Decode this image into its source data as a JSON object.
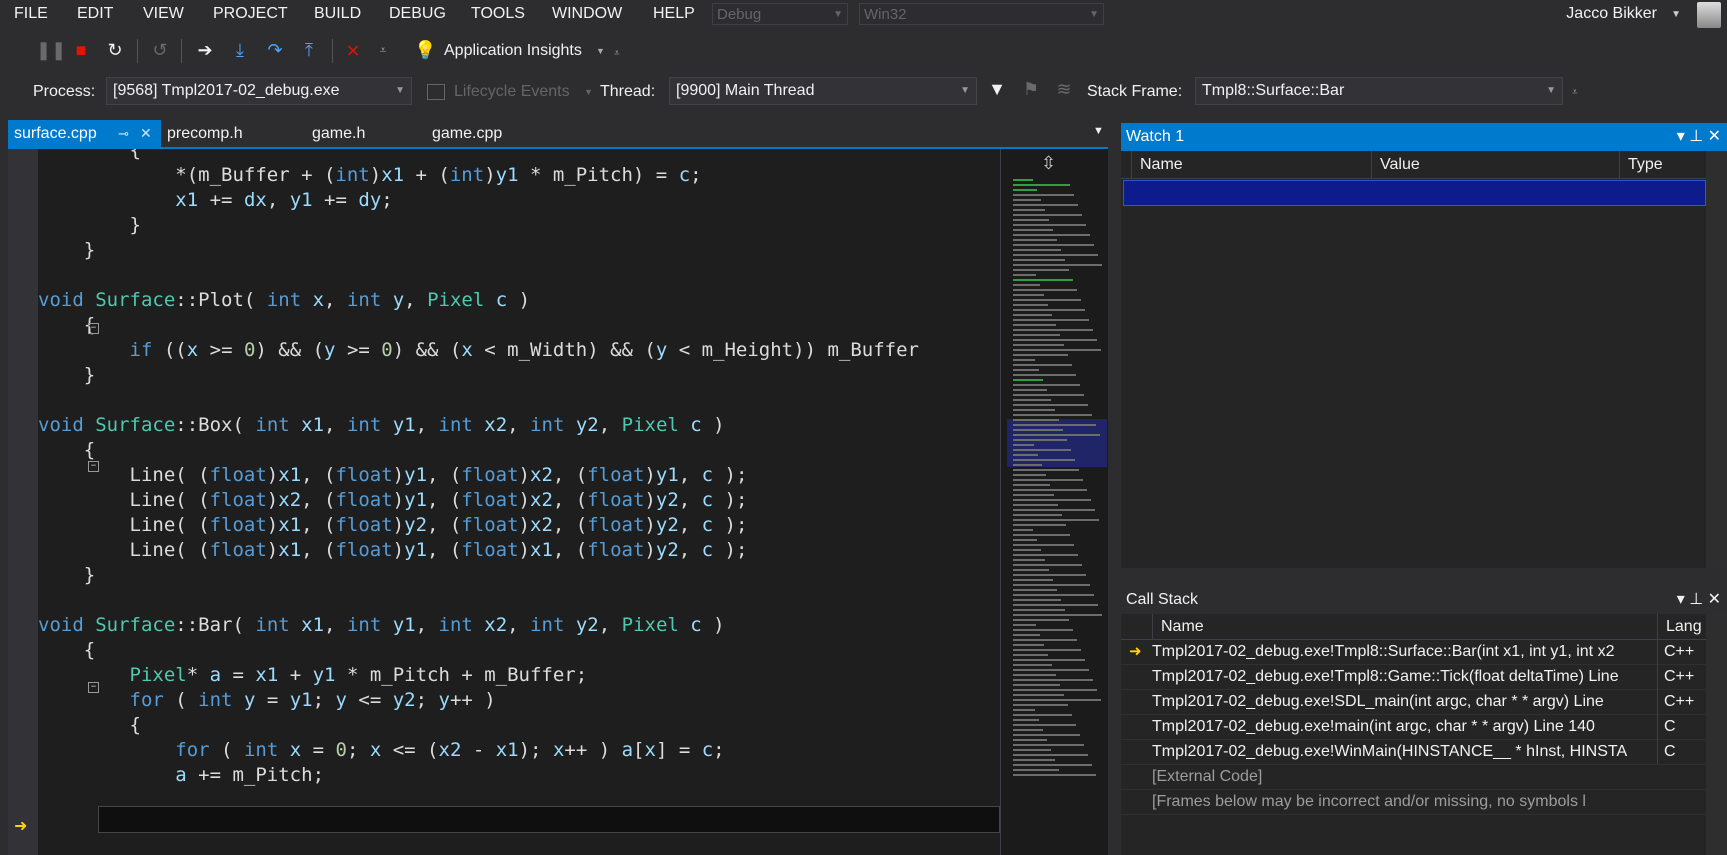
{
  "menu": [
    "FILE",
    "EDIT",
    "VIEW",
    "PROJECT",
    "BUILD",
    "DEBUG",
    "TOOLS",
    "WINDOW",
    "HELP"
  ],
  "config_combo": "Debug",
  "platform_combo": "Win32",
  "user": "Jacco Bikker",
  "toolbar": {
    "insights": "Application Insights"
  },
  "debug_location": {
    "process_label": "Process:",
    "process_value": "[9568] Tmpl2017-02_debug.exe",
    "lifecycle": "Lifecycle Events",
    "thread_label": "Thread:",
    "thread_value": "[9900] Main Thread",
    "stackframe_label": "Stack Frame:",
    "stackframe_value": "Tmpl8::Surface::Bar"
  },
  "tabs": [
    "surface.cpp",
    "precomp.h",
    "game.h",
    "game.cpp"
  ],
  "watch": {
    "title": "Watch 1",
    "columns": [
      "Name",
      "Value",
      "Type"
    ]
  },
  "callstack": {
    "title": "Call Stack",
    "columns": [
      "Name",
      "Lang"
    ],
    "rows": [
      {
        "name": "Tmpl2017-02_debug.exe!Tmpl8::Surface::Bar(int x1, int y1, int x2",
        "lang": "C++"
      },
      {
        "name": "Tmpl2017-02_debug.exe!Tmpl8::Game::Tick(float deltaTime) Line",
        "lang": "C++"
      },
      {
        "name": "Tmpl2017-02_debug.exe!SDL_main(int argc, char * * argv) Line",
        "lang": "C++"
      },
      {
        "name": "Tmpl2017-02_debug.exe!main(int argc, char * * argv) Line 140",
        "lang": "C"
      },
      {
        "name": "Tmpl2017-02_debug.exe!WinMain(HINSTANCE__ * hInst, HINSTA",
        "lang": "C"
      },
      {
        "name": "[External Code]",
        "lang": ""
      },
      {
        "name": "[Frames below may be incorrect and/or missing, no symbols l",
        "lang": ""
      }
    ]
  },
  "code_lines": [
    "        {",
    "            *(m_Buffer + (int)x1 + (int)y1 * m_Pitch) = c;",
    "            x1 += dx, y1 += dy;",
    "        }",
    "    }",
    "",
    "void Surface::Plot( int x, int y, Pixel c )",
    "    {",
    "        if ((x >= 0) && (y >= 0) && (x < m_Width) && (y < m_Height)) m_Buffer",
    "    }",
    "",
    "void Surface::Box( int x1, int y1, int x2, int y2, Pixel c )",
    "    {",
    "        Line( (float)x1, (float)y1, (float)x2, (float)y1, c );",
    "        Line( (float)x2, (float)y1, (float)x2, (float)y2, c );",
    "        Line( (float)x1, (float)y2, (float)x2, (float)y2, c );",
    "        Line( (float)x1, (float)y1, (float)x1, (float)y2, c );",
    "    }",
    "",
    "void Surface::Bar( int x1, int y1, int x2, int y2, Pixel c )",
    "    {",
    "        Pixel* a = x1 + y1 * m_Pitch + m_Buffer;",
    "        for ( int y = y1; y <= y2; y++ )",
    "        {",
    "            for ( int x = 0; x <= (x2 - x1); x++ ) a[x] = c;",
    "            a += m_Pitch;"
  ]
}
